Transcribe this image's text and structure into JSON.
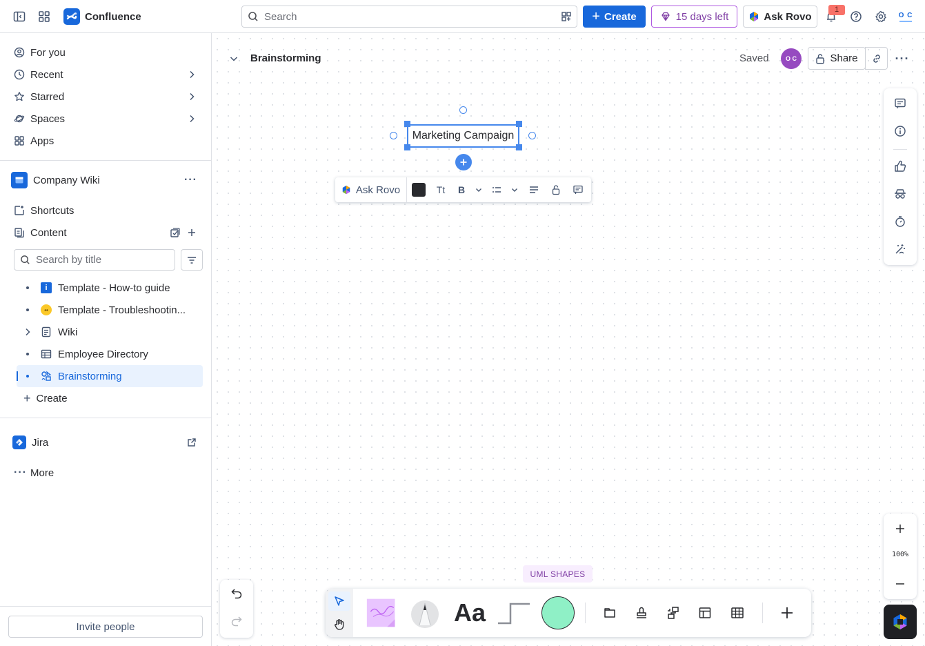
{
  "topbar": {
    "app_name": "Confluence",
    "search_placeholder": "Search",
    "create_label": "Create",
    "trial_label": "15 days left",
    "rovo_label": "Ask Rovo",
    "notification_count": "1"
  },
  "sidebar": {
    "nav": [
      {
        "label": "For you"
      },
      {
        "label": "Recent"
      },
      {
        "label": "Starred"
      },
      {
        "label": "Spaces"
      },
      {
        "label": "Apps"
      }
    ],
    "space_name": "Company Wiki",
    "shortcuts_label": "Shortcuts",
    "content_label": "Content",
    "search_placeholder": "Search by title",
    "tree": [
      {
        "label": "Template - How-to guide"
      },
      {
        "label": "Template - Troubleshootin..."
      },
      {
        "label": "Wiki"
      },
      {
        "label": "Employee Directory"
      },
      {
        "label": "Brainstorming"
      }
    ],
    "create_label": "Create",
    "jira_label": "Jira",
    "more_label": "More",
    "invite_label": "Invite people"
  },
  "page": {
    "title": "Brainstorming",
    "status": "Saved",
    "avatar_initials": "O C",
    "share_label": "Share"
  },
  "whiteboard": {
    "shape_text": "Marketing Campaign",
    "toolbar_rovo": "Ask Rovo",
    "text_size_icon": "Tt",
    "bold_label": "B",
    "zoom_level": "100%",
    "uml_label": "UML SHAPES",
    "text_tool": "Aa"
  },
  "colors": {
    "brand": "#1868db",
    "trial": "#803fa5",
    "selection": "#4688ec",
    "shape_fill": "#8ff0c6"
  }
}
